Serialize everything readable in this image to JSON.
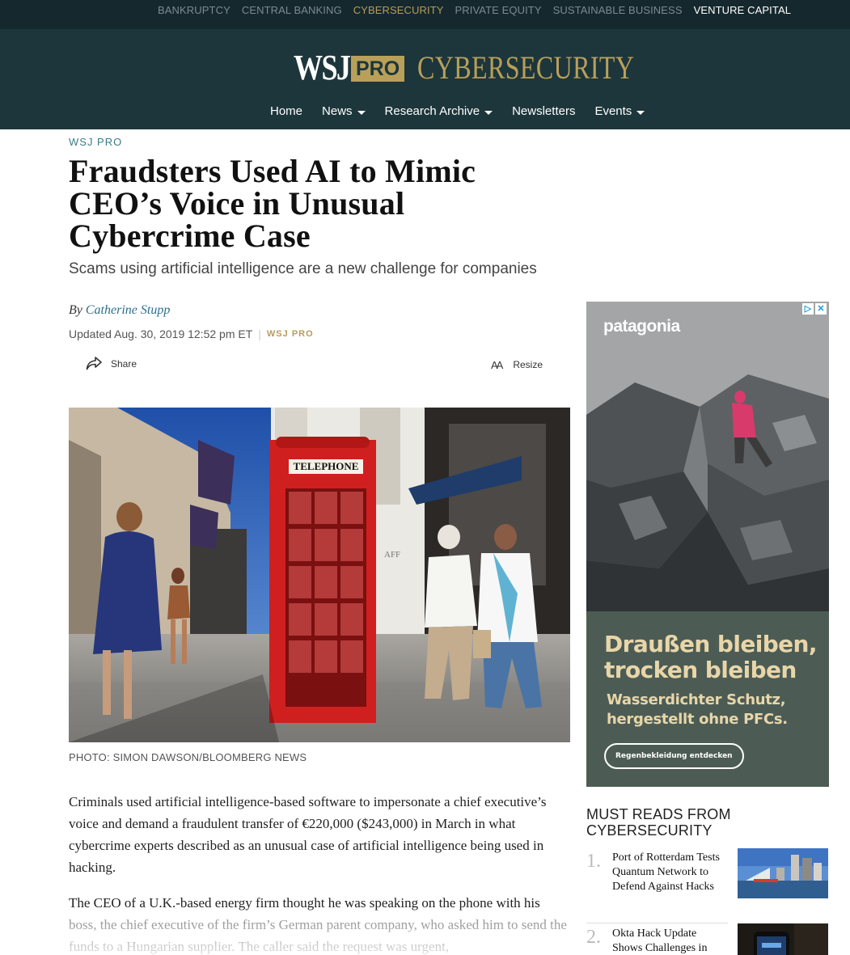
{
  "verticals": [
    "BANKRUPTCY",
    "CENTRAL BANKING",
    "CYBERSECURITY",
    "PRIVATE EQUITY",
    "SUSTAINABLE BUSINESS",
    "VENTURE CAPITAL"
  ],
  "logo": {
    "wsj": "WSJ",
    "pro": "PRO",
    "section": "CYBERSECURITY"
  },
  "nav": {
    "home": "Home",
    "news": "News",
    "research": "Research Archive",
    "newsletters": "Newsletters",
    "events": "Events"
  },
  "article": {
    "kicker": "WSJ PRO",
    "headline": "Fraudsters Used AI to Mimic CEO’s Voice in Unusual Cybercrime Case",
    "dek": "Scams using artificial intelligence are a new challenge for companies",
    "by": "By",
    "author": "Catherine Stupp",
    "updated": "Updated Aug. 30, 2019 12:52 pm ET",
    "source": "WSJ PRO",
    "share_label": "Share",
    "resize_label": "Resize",
    "resize_glyph": "AA",
    "photo_booth_sign": "TELEPHONE",
    "photo_shop_sign": "AFF",
    "caption": "PHOTO: SIMON DAWSON/BLOOMBERG NEWS",
    "paragraphs": [
      "Criminals used artificial intelligence-based software to impersonate a chief executive’s voice and demand a fraudulent transfer of €220,000 ($243,000) in March in what cybercrime experts described as an unusual case of artificial intelligence being used in hacking.",
      "The CEO of a U.K.-based energy firm thought he was speaking on the phone with his boss, the chief executive of the firm’s German parent company, who asked him to send the funds to a Hungarian supplier. The caller said the request was urgent,"
    ]
  },
  "ad": {
    "brand": "patagonia",
    "headline": "Draußen bleiben, trocken bleiben",
    "sub": "Wasserdichter Schutz, hergestellt ohne PFCs.",
    "cta": "Regenbekleidung entdecken",
    "choices_icon": "adchoices-icon",
    "close_icon": "close-icon"
  },
  "must_reads": {
    "title": "MUST READS FROM CYBERSECURITY",
    "items": [
      {
        "num": "1.",
        "title": "Port of Rotterdam Tests Quantum Network to Defend Against Hacks"
      },
      {
        "num": "2.",
        "title": "Okta Hack Update Shows Challenges in"
      }
    ]
  },
  "colors": {
    "masthead": "#1d363b",
    "topbar": "#15282d",
    "gold": "#b9a05a",
    "kicker": "#3a7c87",
    "ad_panel": "#4c5c55"
  }
}
